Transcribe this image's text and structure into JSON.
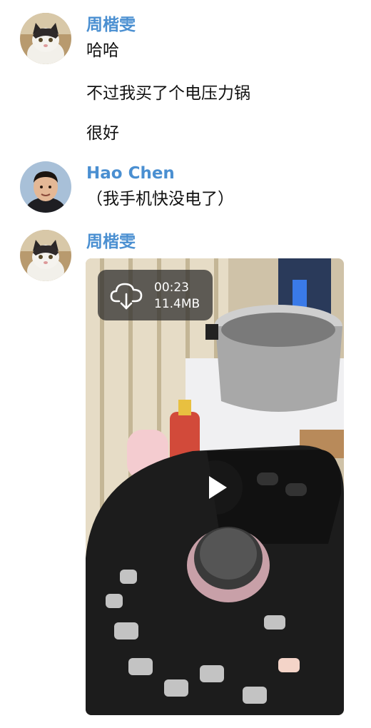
{
  "messages": [
    {
      "sender": "周楷雯",
      "avatar_icon": "cat-avatar",
      "texts": [
        "哈哈",
        "不过我买了个电压力锅",
        "很好"
      ]
    },
    {
      "sender": "Hao Chen",
      "avatar_icon": "person-avatar",
      "texts": [
        "（我手机快没电了）"
      ]
    },
    {
      "sender": "周楷雯",
      "avatar_icon": "cat-avatar",
      "video": {
        "duration": "00:23",
        "size": "11.4MB",
        "download_icon": "cloud-download-icon",
        "play_icon": "play-icon"
      }
    }
  ],
  "colors": {
    "sender_name": "#4a8fd1",
    "text": "#111111",
    "background": "#ffffff"
  }
}
